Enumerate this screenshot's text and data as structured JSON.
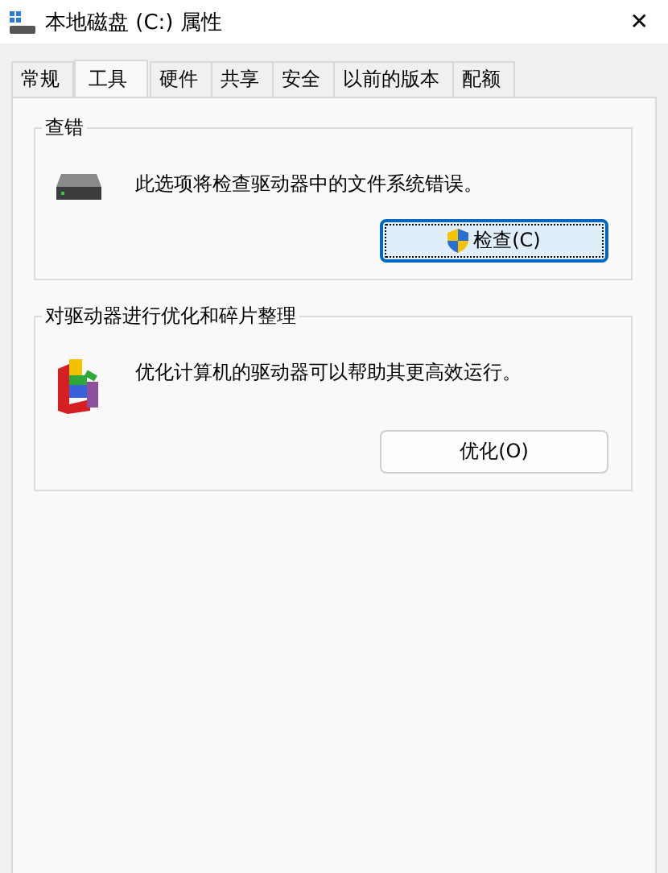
{
  "window": {
    "title": "本地磁盘 (C:) 属性",
    "close": "✕"
  },
  "tabs": [
    {
      "label": "常规",
      "selected": false
    },
    {
      "label": "工具",
      "selected": true
    },
    {
      "label": "硬件",
      "selected": false
    },
    {
      "label": "共享",
      "selected": false
    },
    {
      "label": "安全",
      "selected": false
    },
    {
      "label": "以前的版本",
      "selected": false
    },
    {
      "label": "配额",
      "selected": false
    }
  ],
  "groups": [
    {
      "kind": "check",
      "title": "查错",
      "description": "此选项将检查驱动器中的文件系统错误。",
      "button": {
        "label": "检查(C)",
        "focused": true,
        "shield": true
      }
    },
    {
      "kind": "optimize",
      "title": "对驱动器进行优化和碎片整理",
      "description": "优化计算机的驱动器可以帮助其更高效运行。",
      "button": {
        "label": "优化(O)",
        "focused": false,
        "shield": false
      }
    }
  ]
}
